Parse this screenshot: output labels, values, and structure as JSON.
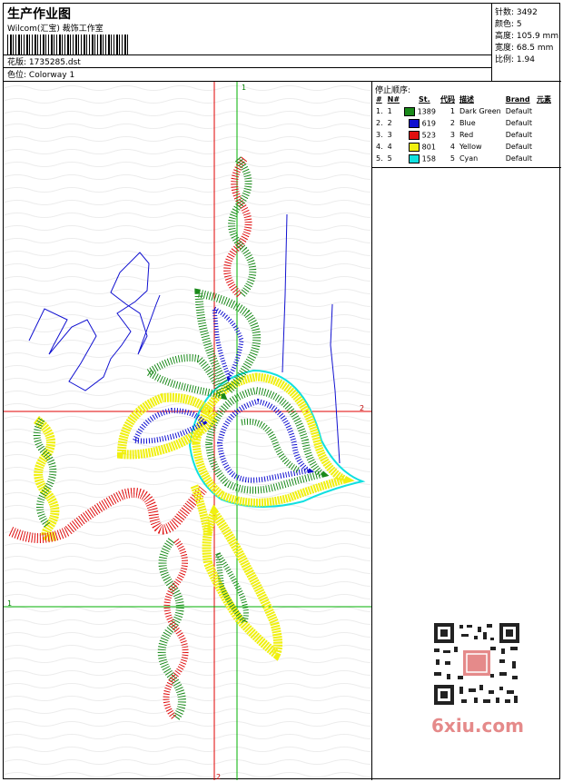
{
  "header": {
    "title": "生产作业图",
    "studio": "Wilcom(汇宝) 裁饰工作室",
    "pattern_label": "花版:",
    "pattern_value": "1735285.dst",
    "colorway_label": "色位:",
    "colorway_value": "Colorway 1"
  },
  "stats": [
    {
      "label": "针数:",
      "value": "3492"
    },
    {
      "label": "颜色:",
      "value": "5"
    },
    {
      "label": "高度:",
      "value": "105.9 mm"
    },
    {
      "label": "宽度:",
      "value": "68.5 mm"
    },
    {
      "label": "比例:",
      "value": "1.94"
    }
  ],
  "guides": {
    "v1": "1",
    "h2": "2",
    "h1": "1",
    "v2": "2"
  },
  "stop_sequence": {
    "label": "停止顺序:",
    "columns": [
      "#",
      "N#",
      "St.",
      "代码",
      "描述",
      "Brand",
      "元素"
    ],
    "rows": [
      {
        "idx": "1.",
        "n": "1",
        "color": "#1a8a1a",
        "st": "1389",
        "code": "1",
        "desc": "Dark Green",
        "brand": "Default"
      },
      {
        "idx": "2.",
        "n": "2",
        "color": "#1010d0",
        "st": "619",
        "code": "2",
        "desc": "Blue",
        "brand": "Default"
      },
      {
        "idx": "3.",
        "n": "3",
        "color": "#e01010",
        "st": "523",
        "code": "3",
        "desc": "Red",
        "brand": "Default"
      },
      {
        "idx": "4.",
        "n": "4",
        "color": "#f0f010",
        "st": "801",
        "code": "4",
        "desc": "Yellow",
        "brand": "Default"
      },
      {
        "idx": "5.",
        "n": "5",
        "color": "#10e0e0",
        "st": "158",
        "code": "5",
        "desc": "Cyan",
        "brand": "Default"
      }
    ]
  },
  "watermark": "6xiu.com",
  "colors": {
    "dark_green": "#1a8a1a",
    "blue": "#1010d0",
    "red": "#e01010",
    "yellow": "#f0f010",
    "cyan": "#10e0e0",
    "guide_red": "#e00000",
    "guide_green": "#00b000"
  }
}
